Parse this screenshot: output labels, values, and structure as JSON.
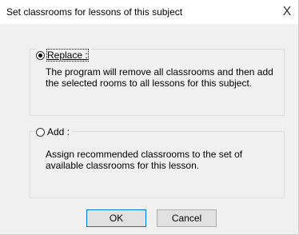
{
  "dialog": {
    "title": "Set classrooms for lessons of this subject",
    "close_glyph": "X"
  },
  "options": [
    {
      "label": "Replace :",
      "selected": true,
      "description": "The program will remove all classrooms and then add the selected rooms to all lessons for this subject."
    },
    {
      "label": "Add :",
      "selected": false,
      "description": "Assign recommended classrooms to the set of available classrooms for this lesson."
    }
  ],
  "buttons": {
    "ok_label": "OK",
    "cancel_label": "Cancel"
  },
  "icons": {
    "close": "close-icon"
  },
  "colors": {
    "background": "#f0f0f0",
    "titlebar": "#ffffff",
    "default_button_border": "#0078d7"
  }
}
